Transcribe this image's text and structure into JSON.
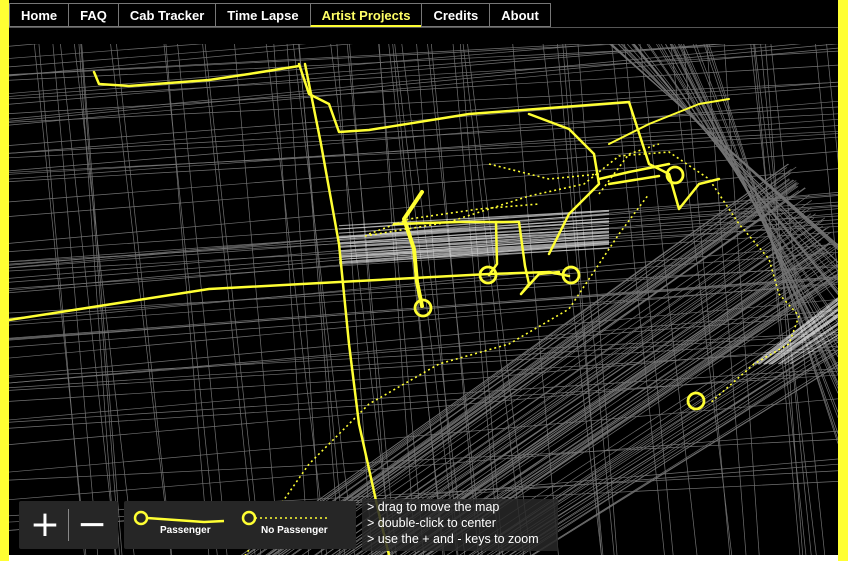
{
  "nav": {
    "tabs": [
      "Home",
      "FAQ",
      "Cab Tracker",
      "Time Lapse",
      "Artist Projects",
      "Credits",
      "About"
    ],
    "active": "Artist Projects"
  },
  "zoom": {
    "in_label": "+",
    "out_label": "−"
  },
  "legend": {
    "passenger_label": "Passenger",
    "no_passenger_label": "No Passenger"
  },
  "help": {
    "lines": [
      "> drag to move the map",
      "> double-click to center",
      "> use the + and - keys to zoom"
    ]
  },
  "colors": {
    "accent": "#ffff33",
    "background": "#000000",
    "streets": "#bbbbbb"
  }
}
